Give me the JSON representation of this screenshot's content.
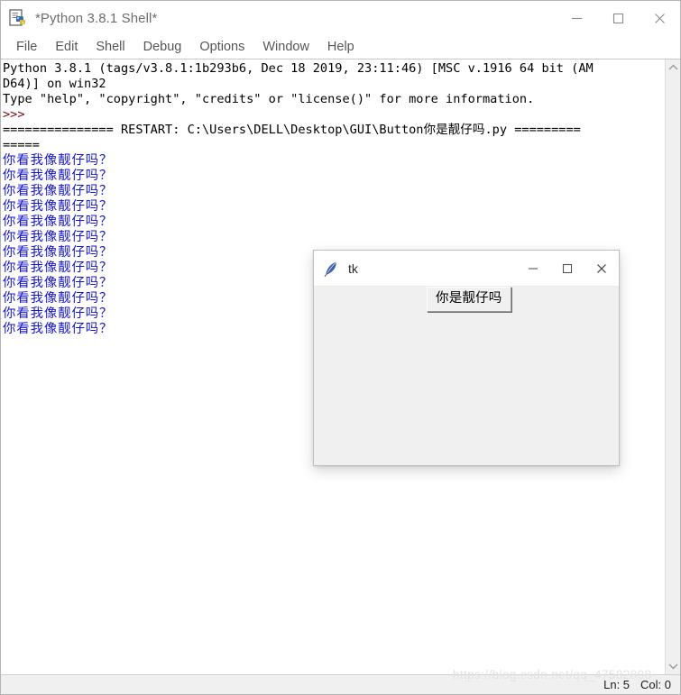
{
  "idle": {
    "title": "*Python 3.8.1 Shell*",
    "app_icon": "idle-python-document-icon",
    "window_controls": [
      {
        "name": "minimize",
        "glyph": "minimize-icon"
      },
      {
        "name": "maximize",
        "glyph": "maximize-icon"
      },
      {
        "name": "close",
        "glyph": "close-icon"
      }
    ],
    "menu": [
      "File",
      "Edit",
      "Shell",
      "Debug",
      "Options",
      "Window",
      "Help"
    ],
    "console": [
      {
        "kind": "normal",
        "text": "Python 3.8.1 (tags/v3.8.1:1b293b6, Dec 18 2019, 23:11:46) [MSC v.1916 64 bit (AM"
      },
      {
        "kind": "normal",
        "text": "D64)] on win32"
      },
      {
        "kind": "normal",
        "text": "Type \"help\", \"copyright\", \"credits\" or \"license()\" for more information."
      },
      {
        "kind": "prompt",
        "text": ">>>"
      },
      {
        "kind": "restart",
        "text": "=============== RESTART: C:\\Users\\DELL\\Desktop\\GUI\\Button你是靓仔吗.py ========="
      },
      {
        "kind": "restart",
        "text": "====="
      },
      {
        "kind": "out",
        "text": "你看我像靓仔吗？"
      },
      {
        "kind": "out",
        "text": "你看我像靓仔吗？"
      },
      {
        "kind": "out",
        "text": "你看我像靓仔吗？"
      },
      {
        "kind": "out",
        "text": "你看我像靓仔吗？"
      },
      {
        "kind": "out",
        "text": "你看我像靓仔吗？"
      },
      {
        "kind": "out",
        "text": "你看我像靓仔吗？"
      },
      {
        "kind": "out",
        "text": "你看我像靓仔吗？"
      },
      {
        "kind": "out",
        "text": "你看我像靓仔吗？"
      },
      {
        "kind": "out",
        "text": "你看我像靓仔吗？"
      },
      {
        "kind": "out",
        "text": "你看我像靓仔吗？"
      },
      {
        "kind": "out",
        "text": "你看我像靓仔吗？"
      },
      {
        "kind": "out",
        "text": "你看我像靓仔吗？"
      }
    ],
    "scrollbar": {
      "up_arrow": "chevron-up-icon",
      "down_arrow": "chevron-down-icon"
    },
    "status": {
      "line": "Ln: 5",
      "col": "Col: 0"
    },
    "colors": {
      "prompt": "#7a0c0c",
      "output": "#1414cf",
      "text": "#000000"
    }
  },
  "tk_window": {
    "title": "tk",
    "icon": "tk-feather-icon",
    "window_controls": [
      {
        "name": "minimize",
        "glyph": "minimize-icon"
      },
      {
        "name": "maximize",
        "glyph": "maximize-icon"
      },
      {
        "name": "close",
        "glyph": "close-icon"
      }
    ],
    "button_label": "你是靓仔吗"
  },
  "watermark": {
    "text": "https://blog.csdn.net/qq_47582808"
  }
}
